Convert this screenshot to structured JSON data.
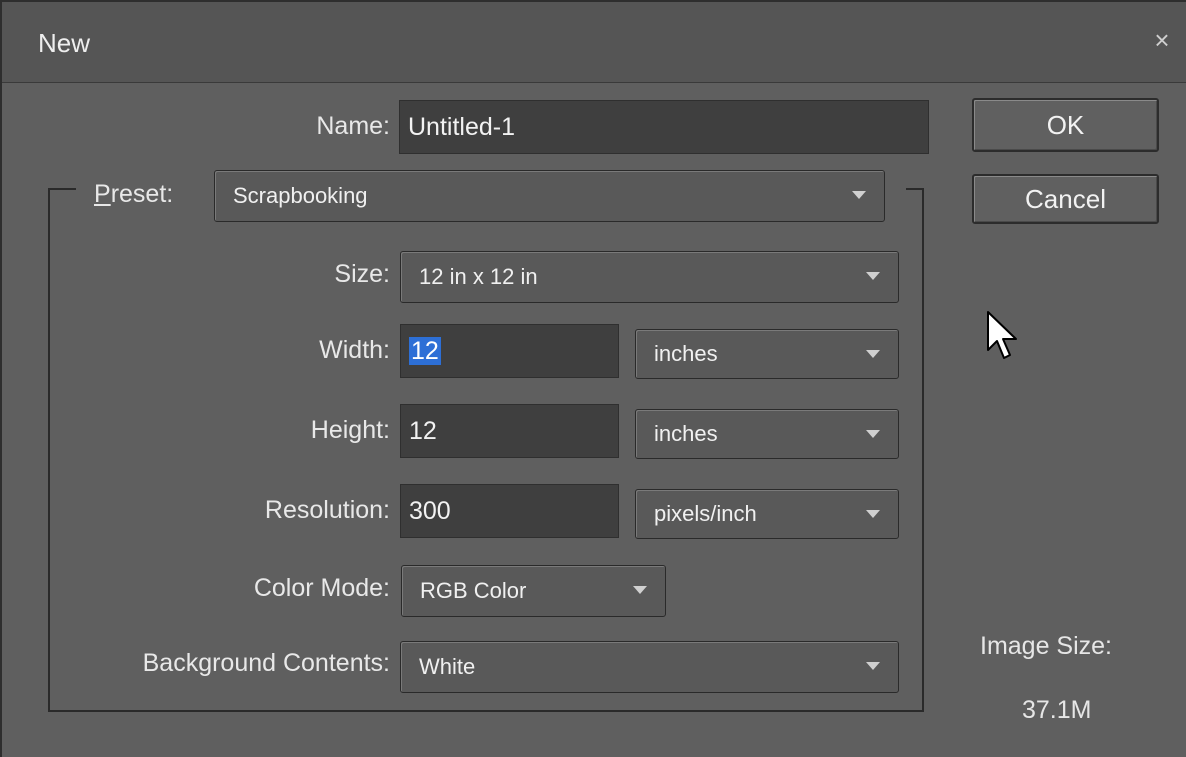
{
  "window": {
    "title": "New",
    "close_glyph": "×"
  },
  "form": {
    "name_label": "Name:",
    "name_value": "Untitled-1",
    "preset_label_first": "P",
    "preset_label_rest": "reset:",
    "preset_value": "Scrapbooking",
    "size_label": "Size:",
    "size_value": "12 in x 12 in",
    "width_label": "Width:",
    "width_value": "12",
    "width_unit": "inches",
    "height_label": "Height:",
    "height_value": "12",
    "height_unit": "inches",
    "resolution_label": "Resolution:",
    "resolution_value": "300",
    "resolution_unit": "pixels/inch",
    "color_mode_label": "Color Mode:",
    "color_mode_value": "RGB Color",
    "background_label": "Background Contents:",
    "background_value": "White"
  },
  "buttons": {
    "ok": "OK",
    "cancel": "Cancel"
  },
  "info": {
    "image_size_label": "Image Size:",
    "image_size_value": "37.1M"
  },
  "icons": {
    "close": "close-icon",
    "dropdown": "chevron-down-icon",
    "cursor": "mouse-pointer-icon"
  },
  "colors": {
    "selection": "#2d6fd6",
    "dialog_bg": "#5f5f5f",
    "field_bg": "#3f3f3f"
  }
}
